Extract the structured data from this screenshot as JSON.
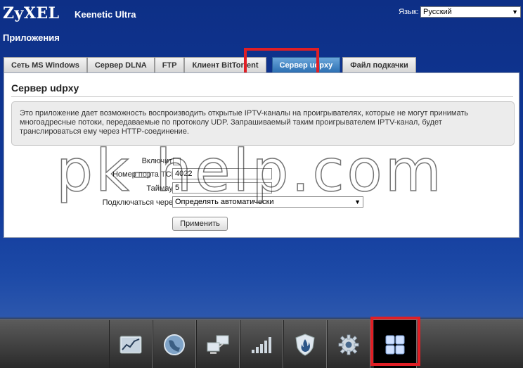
{
  "header": {
    "logo": "ZyXEL",
    "model": "Keenetic Ultra",
    "language_label": "Язык:",
    "language_value": "Русский",
    "section_title": "Приложения"
  },
  "tabs": [
    {
      "label": "Сеть MS Windows",
      "active": false
    },
    {
      "label": "Сервер DLNA",
      "active": false
    },
    {
      "label": "FTP",
      "active": false
    },
    {
      "label": "Клиент BitTorrent",
      "active": false
    },
    {
      "label": "Сервер udpxy",
      "active": true
    },
    {
      "label": "Файл подкачки",
      "active": false
    }
  ],
  "panel": {
    "title": "Сервер udpxy",
    "info_lines": [
      "Это приложение дает возможность воспроизводить открытые IPTV-каналы на проигрывателях, которые не могут принимать",
      "многоадресные потоки, передаваемые по протоколу UDP. Запрашиваемый таким проигрывателем IPTV-канал, будет",
      "транслироваться ему через HTTP-соединение."
    ],
    "enable_label": "Включить:",
    "enable_checked": false,
    "port_label": "Номер порта TCP:",
    "port_value": "4022",
    "timeout_label": "Таймаут:",
    "timeout_value": "5",
    "connect_label": "Подключаться через:",
    "connect_value": "Определять автоматически",
    "apply_label": "Применить"
  },
  "watermark": "pk-help.com",
  "toolbar": {
    "icons": [
      "chart-icon",
      "globe-icon",
      "network-icon",
      "signal-icon",
      "shield-icon",
      "gear-icon",
      "apps-grid-icon"
    ],
    "active_icon": "apps-grid-icon"
  },
  "colors": {
    "highlight": "#e01f25",
    "active_tab": "#2c6fb2",
    "background": "#113a9b"
  }
}
